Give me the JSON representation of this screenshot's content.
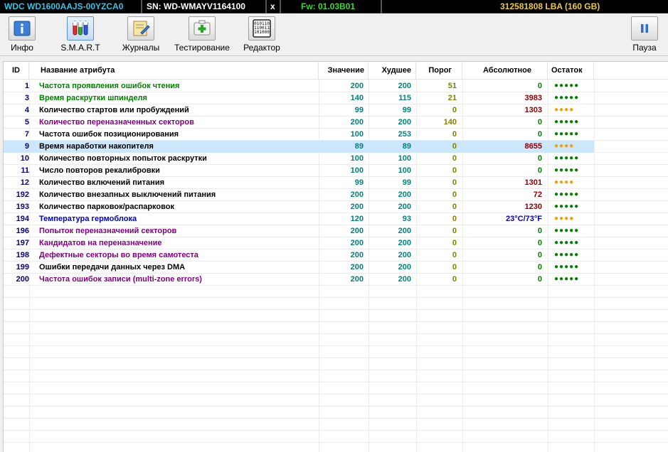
{
  "infobar": {
    "model": "WDC WD1600AAJS-00YZCA0",
    "serial": "SN: WD-WMAYV1164100",
    "close": "x",
    "firmware": "Fw: 01.03B01",
    "capacity": "312581808 LBA (160 GB)",
    "colors": {
      "model": "#33c4e6",
      "serial": "#ffffff",
      "firmware": "#33dd33",
      "capacity": "#eecc33"
    }
  },
  "toolbar": {
    "info": {
      "label": "Инфо",
      "icon": "info-icon"
    },
    "smart": {
      "label": "S.M.A.R.T",
      "icon": "test-tubes-icon"
    },
    "logs": {
      "label": "Журналы",
      "icon": "journal-icon"
    },
    "test": {
      "label": "Тестирование",
      "icon": "first-aid-icon"
    },
    "editor": {
      "label": "Редактор",
      "icon": "binary-editor-icon"
    },
    "pause": {
      "label": "Пауза",
      "icon": "pause-icon"
    }
  },
  "table": {
    "headers": {
      "id": "ID",
      "name": "Название атрибута",
      "value": "Значение",
      "worst": "Худшее",
      "threshold": "Порог",
      "raw": "Абсолютное",
      "remaining": "Остаток"
    },
    "selected_row": 5,
    "rows": [
      {
        "id": "1",
        "name": "Частота проявления ошибок чтения",
        "name_color": "#008000",
        "value": "200",
        "worst": "200",
        "threshold": "51",
        "raw": "0",
        "remaining": "●●●●●",
        "remaining_color": "#008000"
      },
      {
        "id": "3",
        "name": "Время раскрутки шпинделя",
        "name_color": "#008000",
        "value": "140",
        "worst": "115",
        "threshold": "21",
        "raw": "3983",
        "remaining": "●●●●●",
        "remaining_color": "#008000"
      },
      {
        "id": "4",
        "name": "Количество стартов или пробуждений",
        "name_color": "#000000",
        "value": "99",
        "worst": "99",
        "threshold": "0",
        "raw": "1303",
        "remaining": "●●●●",
        "remaining_color": "#f0a000"
      },
      {
        "id": "5",
        "name": "Количество переназначенных секторов",
        "name_color": "#800080",
        "value": "200",
        "worst": "200",
        "threshold": "140",
        "raw": "0",
        "remaining": "●●●●●",
        "remaining_color": "#008000"
      },
      {
        "id": "7",
        "name": "Частота ошибок позиционирования",
        "name_color": "#000000",
        "value": "100",
        "worst": "253",
        "threshold": "0",
        "raw": "0",
        "remaining": "●●●●●",
        "remaining_color": "#008000"
      },
      {
        "id": "9",
        "name": "Время наработки накопителя",
        "name_color": "#000000",
        "value": "89",
        "worst": "89",
        "threshold": "0",
        "raw": "8655",
        "remaining": "●●●●",
        "remaining_color": "#f0a000"
      },
      {
        "id": "10",
        "name": "Количество повторных попыток раскрутки",
        "name_color": "#000000",
        "value": "100",
        "worst": "100",
        "threshold": "0",
        "raw": "0",
        "remaining": "●●●●●",
        "remaining_color": "#008000"
      },
      {
        "id": "11",
        "name": "Число повторов рекалибровки",
        "name_color": "#000000",
        "value": "100",
        "worst": "100",
        "threshold": "0",
        "raw": "0",
        "remaining": "●●●●●",
        "remaining_color": "#008000"
      },
      {
        "id": "12",
        "name": "Количество включений питания",
        "name_color": "#000000",
        "value": "99",
        "worst": "99",
        "threshold": "0",
        "raw": "1301",
        "remaining": "●●●●",
        "remaining_color": "#f0a000"
      },
      {
        "id": "192",
        "name": "Количество внезапных выключений питания",
        "name_color": "#000000",
        "value": "200",
        "worst": "200",
        "threshold": "0",
        "raw": "72",
        "remaining": "●●●●●",
        "remaining_color": "#008000"
      },
      {
        "id": "193",
        "name": "Количество парковок/распарковок",
        "name_color": "#000000",
        "value": "200",
        "worst": "200",
        "threshold": "0",
        "raw": "1230",
        "remaining": "●●●●●",
        "remaining_color": "#008000"
      },
      {
        "id": "194",
        "name": "Температура гермоблока",
        "name_color": "#0000c0",
        "value": "120",
        "worst": "93",
        "threshold": "0",
        "raw": "23°C/73°F",
        "remaining": "●●●●",
        "remaining_color": "#f0a000"
      },
      {
        "id": "196",
        "name": "Попыток переназначений секторов",
        "name_color": "#800080",
        "value": "200",
        "worst": "200",
        "threshold": "0",
        "raw": "0",
        "remaining": "●●●●●",
        "remaining_color": "#008000"
      },
      {
        "id": "197",
        "name": "Кандидатов на переназначение",
        "name_color": "#800080",
        "value": "200",
        "worst": "200",
        "threshold": "0",
        "raw": "0",
        "remaining": "●●●●●",
        "remaining_color": "#008000"
      },
      {
        "id": "198",
        "name": "Дефектные секторы во время самотеста",
        "name_color": "#800080",
        "value": "200",
        "worst": "200",
        "threshold": "0",
        "raw": "0",
        "remaining": "●●●●●",
        "remaining_color": "#008000"
      },
      {
        "id": "199",
        "name": "Ошибки передачи данных через DMA",
        "name_color": "#000000",
        "value": "200",
        "worst": "200",
        "threshold": "0",
        "raw": "0",
        "remaining": "●●●●●",
        "remaining_color": "#008000"
      },
      {
        "id": "200",
        "name": "Частота ошибок записи (multi-zone errors)",
        "name_color": "#800080",
        "value": "200",
        "worst": "200",
        "threshold": "0",
        "raw": "0",
        "remaining": "●●●●●",
        "remaining_color": "#008000"
      }
    ],
    "colors": {
      "id": "#000080",
      "value": "#008080",
      "worst": "#008080",
      "threshold_nonzero": "#808000",
      "threshold_zero": "#808000",
      "raw_nonzero": "#8b0000",
      "raw_zero": "#008000",
      "raw_temperature": "#0000c0",
      "selected_row_bg": "#cce6fb"
    }
  }
}
